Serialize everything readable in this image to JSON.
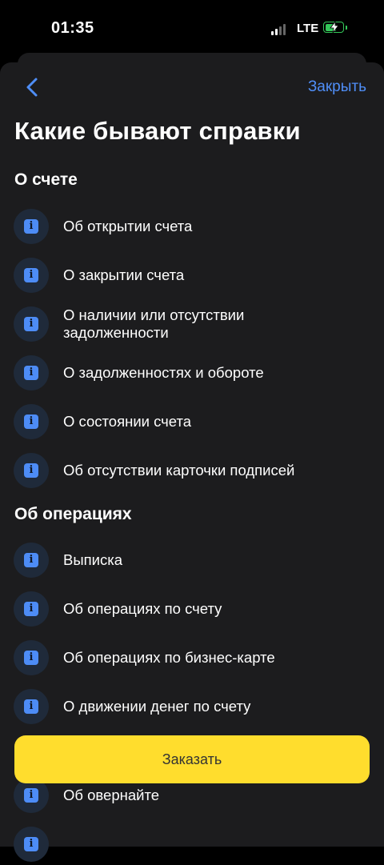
{
  "status_bar": {
    "time": "01:35",
    "network": "LTE",
    "battery_level": 0.5,
    "battery_color": "#34c759"
  },
  "header": {
    "back_icon": "chevron-left-icon",
    "close_label": "Закрыть",
    "accent_color": "#4f8ef7"
  },
  "title": "Какие бывают справки",
  "sections": [
    {
      "title": "О счете",
      "items": [
        "Об открытии счета",
        "О закрытии счета",
        "О наличии или отсутствии задолженности",
        "О задолженностях и обороте",
        "О состоянии счета",
        "Об отсутствии карточки подписей"
      ]
    },
    {
      "title": "Об операциях",
      "items": [
        "Выписка",
        "Об операциях по счету",
        "Об операциях по бизнес-карте",
        "О движении денег по счету",
        "",
        "Об овернайте"
      ]
    }
  ],
  "item_icon": "info-icon",
  "order_button": {
    "label": "Заказать",
    "color": "#ffdd2d"
  }
}
